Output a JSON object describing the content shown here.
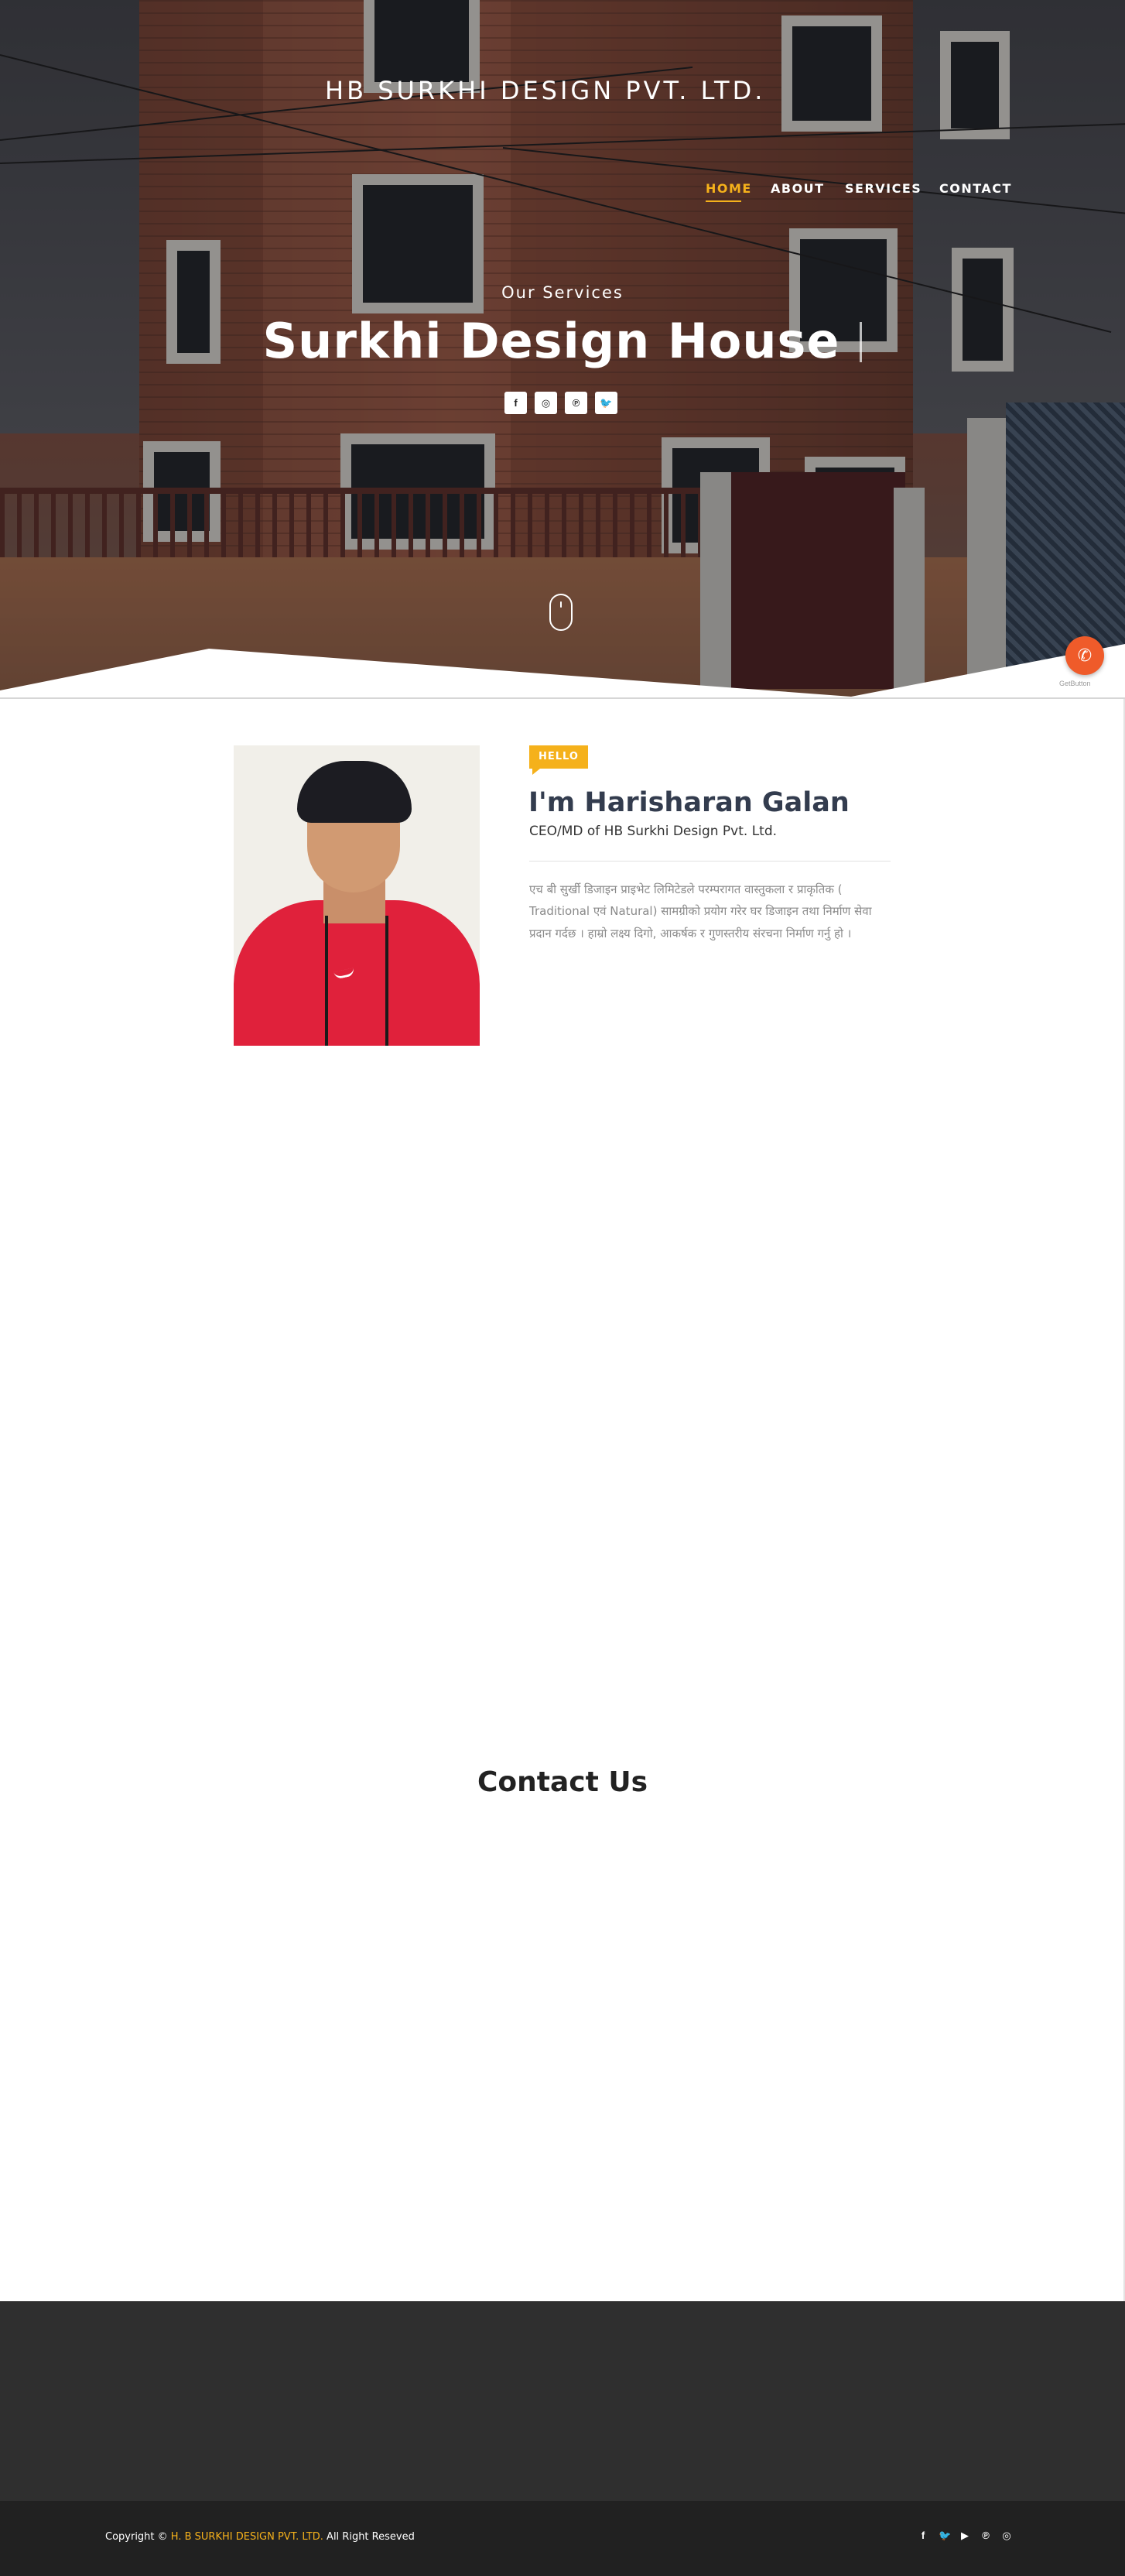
{
  "brand": {
    "name": "HB SURKHI DESIGN PVT. LTD."
  },
  "nav": {
    "items": [
      {
        "label": "HOME",
        "active": true
      },
      {
        "label": "ABOUT",
        "active": false
      },
      {
        "label": "SERVICES",
        "active": false
      },
      {
        "label": "CONTACT",
        "active": false
      }
    ]
  },
  "hero": {
    "subtitle": "Our Services",
    "headline": "Surkhi Design House",
    "social": [
      {
        "icon": "facebook-icon",
        "glyph": "f"
      },
      {
        "icon": "instagram-icon",
        "glyph": "◎"
      },
      {
        "icon": "pinterest-icon",
        "glyph": "℗"
      },
      {
        "icon": "twitter-icon",
        "glyph": "🐦"
      }
    ]
  },
  "getbutton": {
    "label": "GetButton"
  },
  "about": {
    "badge": "HELLO",
    "name_prefix": "I'm",
    "name": "Harisharan Galan",
    "role": "CEO/MD of HB Surkhi Design Pvt. Ltd.",
    "bio": "एच बी सुर्खी डिजाइन प्राइभेट लिमिटेडले परम्परागत वास्तुकला र प्राकृतिक ( Traditional एवं Natural) सामग्रीको प्रयोग गरेर घर डिजाइन तथा निर्माण सेवा प्रदान गर्दछ । हाम्रो लक्ष्य दिगो, आकर्षक र गुणस्तरीय संरचना निर्माण गर्नु हो ।"
  },
  "contact": {
    "title": "Contact Us"
  },
  "footer": {
    "copyright_prefix": "Copyright ©",
    "company": "H. B SURKHI DESIGN PVT. LTD.",
    "copyright_suffix": "All Right Reseved",
    "social": [
      {
        "icon": "facebook-icon",
        "glyph": "f"
      },
      {
        "icon": "twitter-icon",
        "glyph": "🐦"
      },
      {
        "icon": "youtube-icon",
        "glyph": "▶"
      },
      {
        "icon": "pinterest-icon",
        "glyph": "℗"
      },
      {
        "icon": "instagram-icon",
        "glyph": "◎"
      }
    ]
  },
  "colors": {
    "accent": "#f5b11b",
    "getbutton": "#ef5b2a",
    "footer_top": "#2f2f2f",
    "footer_bottom": "#212121"
  }
}
